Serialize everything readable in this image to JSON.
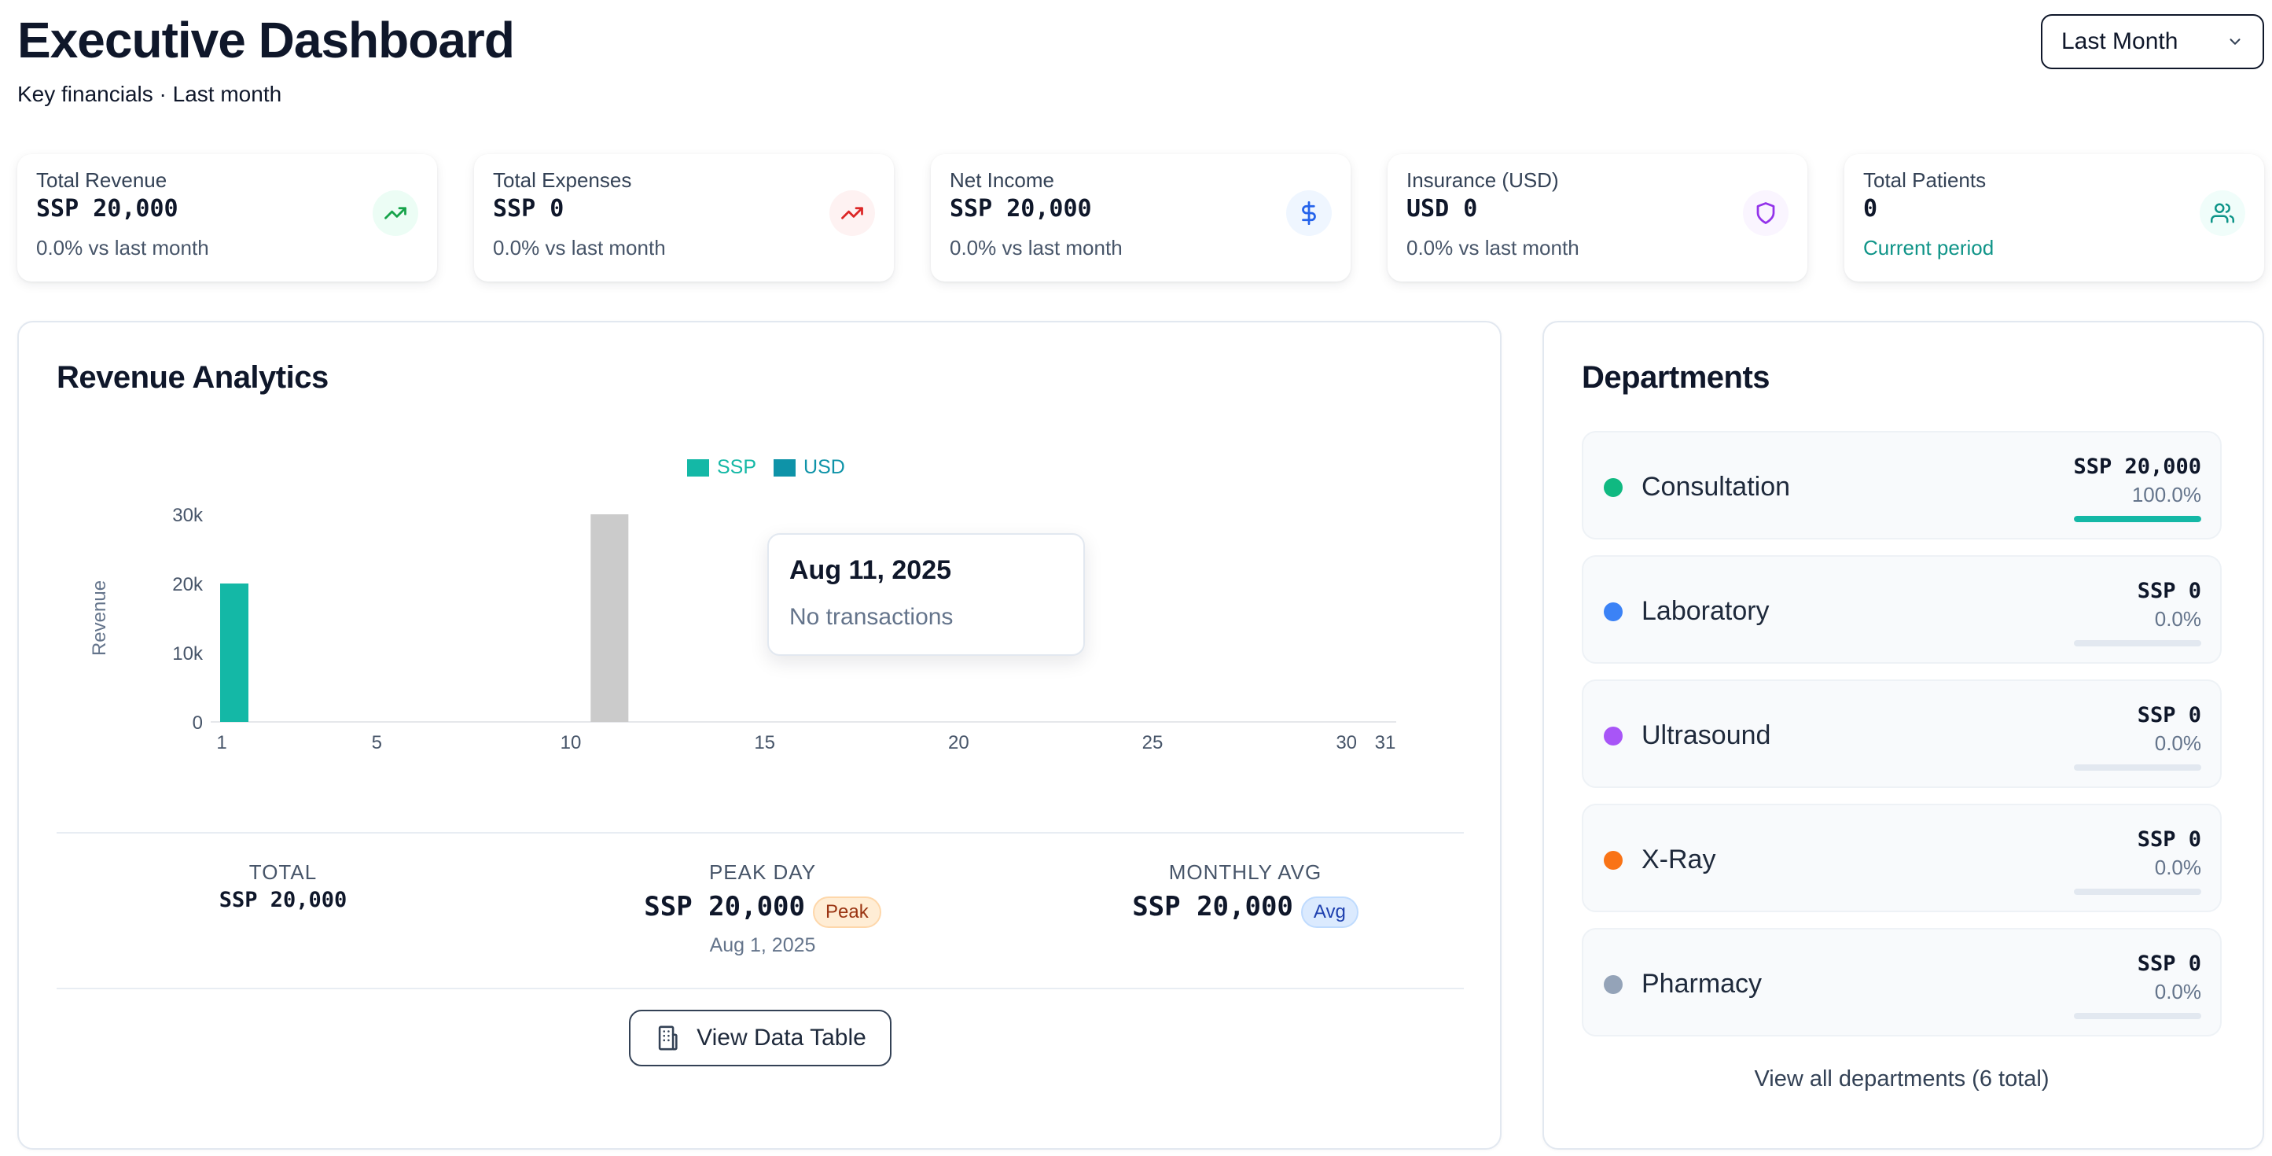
{
  "header": {
    "title": "Executive Dashboard",
    "subtitle": "Key financials · Last month",
    "period_select": {
      "value": "Last Month",
      "icon": "chevron-down-icon"
    }
  },
  "kpis": [
    {
      "label": "Total Revenue",
      "value": "SSP 20,000",
      "delta": "0.0% vs last month",
      "icon": "trending-up-icon",
      "icon_color": "#16a34a",
      "icon_bg": "#ecfdf5"
    },
    {
      "label": "Total Expenses",
      "value": "SSP 0",
      "delta": "0.0% vs last month",
      "icon": "trending-up-icon",
      "icon_color": "#dc2626",
      "icon_bg": "#fef2f2"
    },
    {
      "label": "Net Income",
      "value": "SSP 20,000",
      "delta": "0.0% vs last month",
      "icon": "dollar-icon",
      "icon_color": "#2563eb",
      "icon_bg": "#eff6ff"
    },
    {
      "label": "Insurance (USD)",
      "value": "USD 0",
      "delta": "0.0% vs last month",
      "icon": "shield-icon",
      "icon_color": "#9333ea",
      "icon_bg": "#faf5ff"
    },
    {
      "label": "Total Patients",
      "value": "0",
      "delta": "Current period",
      "icon": "users-icon",
      "icon_color": "#0d9488",
      "icon_bg": "#f0fdfa"
    }
  ],
  "revenue": {
    "title": "Revenue Analytics",
    "tooltip": {
      "date": "Aug 11, 2025",
      "message": "No transactions"
    },
    "stats": {
      "total_label": "TOTAL",
      "total_value": "SSP 20,000",
      "peak_label": "PEAK DAY",
      "peak_value": "SSP 20,000",
      "peak_badge": "Peak",
      "peak_date": "Aug 1, 2025",
      "avg_label": "MONTHLY AVG",
      "avg_value": "SSP 20,000",
      "avg_badge": "Avg"
    },
    "view_table_label": "View Data Table"
  },
  "chart_data": {
    "type": "bar",
    "ylabel": "Revenue",
    "xlabel": "",
    "x_ticks": [
      1,
      5,
      10,
      15,
      20,
      25,
      30,
      31
    ],
    "x_range": [
      1,
      31
    ],
    "y_ticks": [
      0,
      10000,
      20000,
      30000
    ],
    "y_tick_labels": [
      "0",
      "10k",
      "20k",
      "30k"
    ],
    "ylim": [
      0,
      30000
    ],
    "legend_position": "top-center",
    "grid": false,
    "series": [
      {
        "name": "SSP",
        "color": "#14b8a6",
        "points": [
          {
            "x": 1,
            "y": 20000
          }
        ]
      },
      {
        "name": "USD",
        "color": "#0e93a8",
        "points": []
      }
    ],
    "highlight": {
      "x": 11,
      "y": 30000,
      "color": "#cbcbcb"
    }
  },
  "departments": {
    "title": "Departments",
    "items": [
      {
        "name": "Consultation",
        "amount": "SSP 20,000",
        "percent": "100.0%",
        "share": 1.0,
        "dot_color": "#10b981",
        "bar_color": "#14b8a6"
      },
      {
        "name": "Laboratory",
        "amount": "SSP 0",
        "percent": "0.0%",
        "share": 0.0,
        "dot_color": "#3b82f6",
        "bar_color": "#3b82f6"
      },
      {
        "name": "Ultrasound",
        "amount": "SSP 0",
        "percent": "0.0%",
        "share": 0.0,
        "dot_color": "#a855f7",
        "bar_color": "#a855f7"
      },
      {
        "name": "X-Ray",
        "amount": "SSP 0",
        "percent": "0.0%",
        "share": 0.0,
        "dot_color": "#f97316",
        "bar_color": "#f97316"
      },
      {
        "name": "Pharmacy",
        "amount": "SSP 0",
        "percent": "0.0%",
        "share": 0.0,
        "dot_color": "#94a3b8",
        "bar_color": "#94a3b8"
      }
    ],
    "view_all_label": "View all departments (6 total)"
  }
}
